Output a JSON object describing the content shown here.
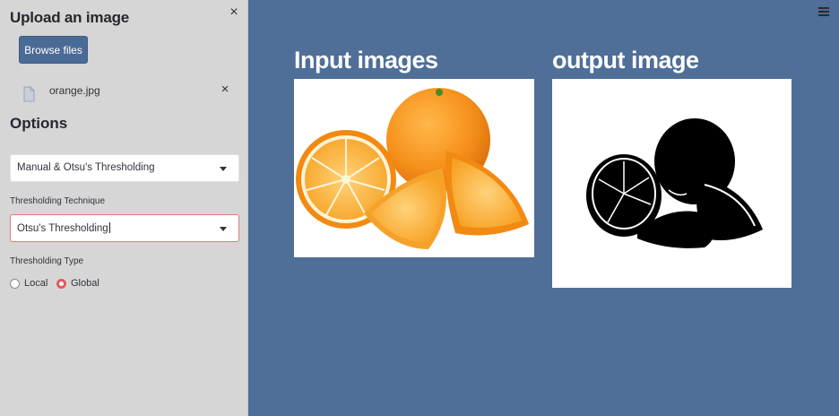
{
  "sidebar": {
    "upload_title": "Upload an image",
    "browse_label": "Browse files",
    "file_name": "orange.jpg",
    "options_title": "Options",
    "mode_select": {
      "value": "Manual & Otsu's Thresholding"
    },
    "technique": {
      "label": "Thresholding Technique",
      "value": "Otsu's Thresholding"
    },
    "type": {
      "label": "Thresholding Type",
      "options": [
        "Local",
        "Global"
      ],
      "selected": "Global"
    }
  },
  "main": {
    "input_title": "Input images",
    "output_title": "output image"
  },
  "colors": {
    "sidebar_bg": "#d6d6d6",
    "main_bg": "#4f6e98",
    "button_bg": "#4a6b95",
    "radio_accent": "#e35b5b"
  },
  "icons": {
    "close": "close-icon",
    "file": "file-icon",
    "remove": "close-icon",
    "caret": "chevron-down-icon",
    "menu": "hamburger-menu-icon"
  }
}
